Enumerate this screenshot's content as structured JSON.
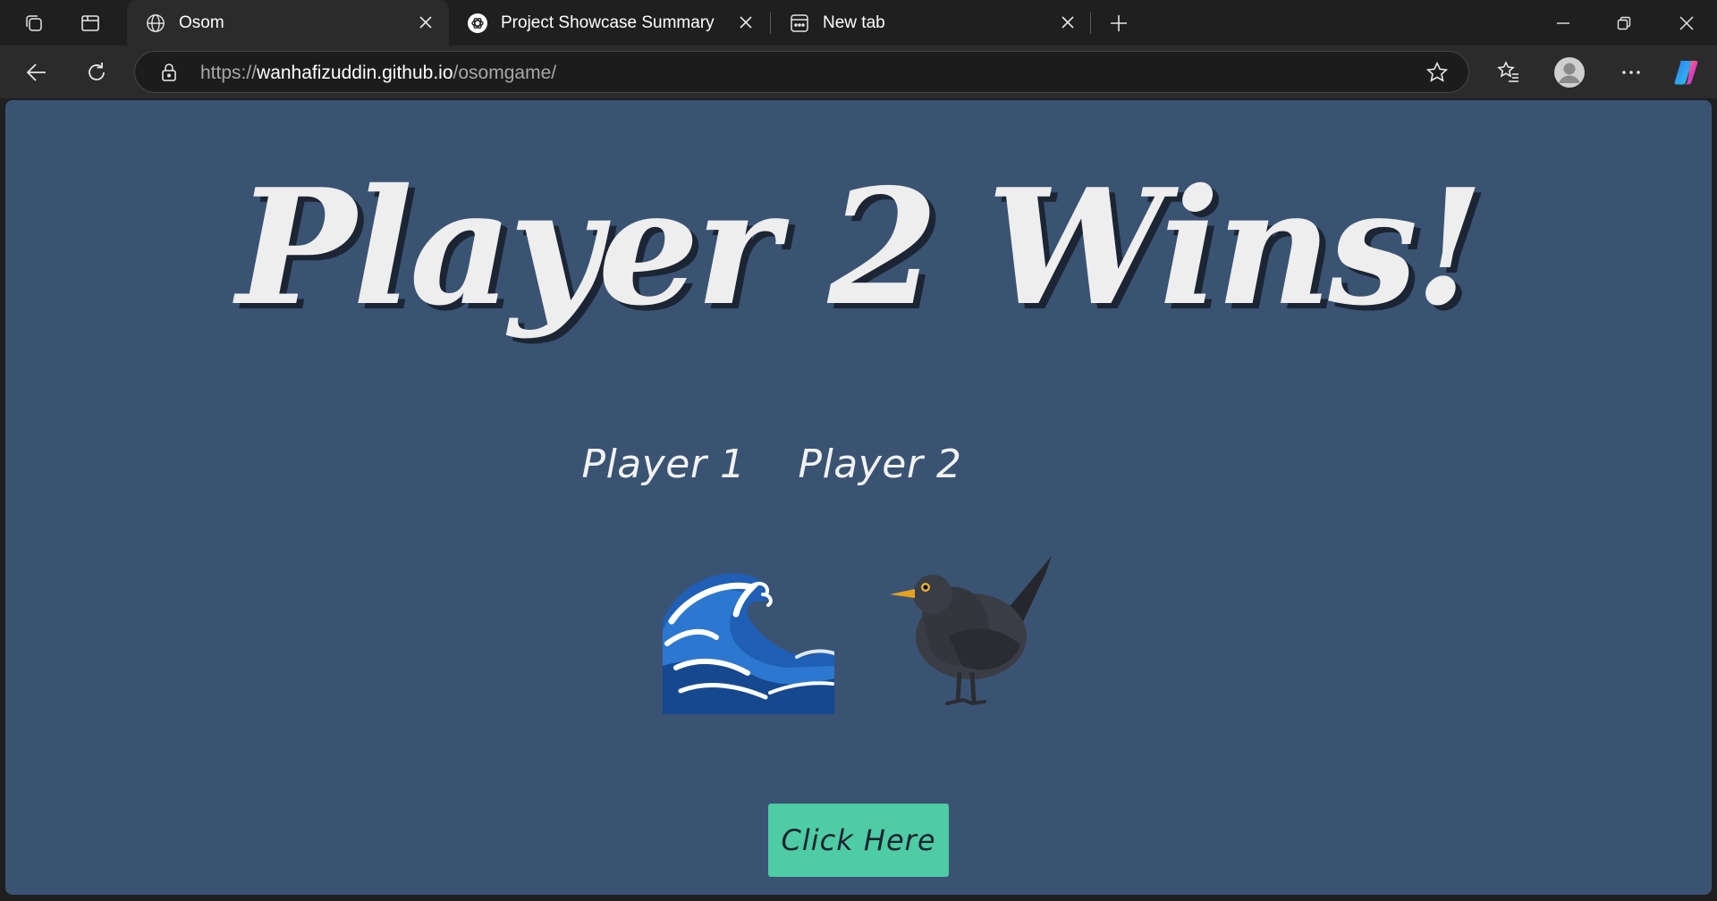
{
  "browser": {
    "tabs": [
      {
        "title": "Osom",
        "icon": "globe-icon",
        "active": true
      },
      {
        "title": "Project Showcase Summary",
        "icon": "openai-icon",
        "active": false
      },
      {
        "title": "New tab",
        "icon": "newtab-icon",
        "active": false
      }
    ],
    "address": {
      "scheme": "https://",
      "host": "wanhafizuddin.github.io",
      "path": "/osomgame/"
    }
  },
  "page": {
    "headline": "Player 2 Wins!",
    "player1_label": "Player 1",
    "player2_label": "Player 2",
    "player1_choice": "wave",
    "player2_choice": "blackbird",
    "button_label": "Click Here",
    "colors": {
      "background": "#3a5373",
      "button": "#4ecca3",
      "headline": "#eeeeee"
    }
  }
}
